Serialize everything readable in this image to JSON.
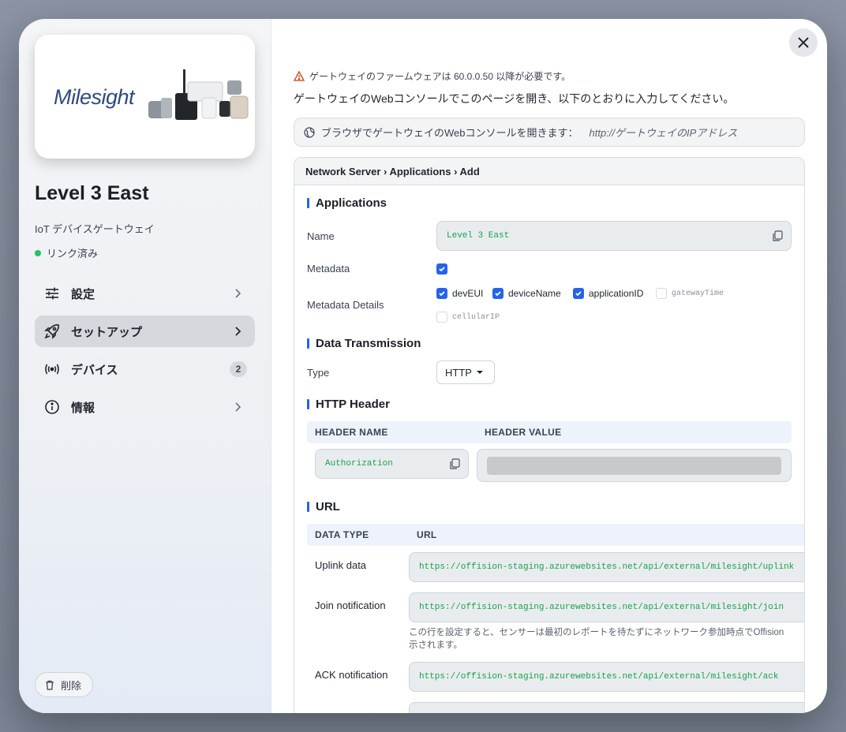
{
  "sidebar": {
    "logo_text": "Milesight",
    "title": "Level 3 East",
    "subtitle": "IoT デバイスゲートウェイ",
    "status": "リンク済み",
    "nav": [
      {
        "label": "設定",
        "icon": "sliders-icon"
      },
      {
        "label": "セットアップ",
        "icon": "rocket-icon"
      },
      {
        "label": "デバイス",
        "icon": "broadcast-icon",
        "badge": "2"
      },
      {
        "label": "情報",
        "icon": "info-icon"
      }
    ],
    "delete_label": "削除"
  },
  "main": {
    "warning": "ゲートウェイのファームウェアは 60.0.0.50 以降が必要です。",
    "intro": "ゲートウェイのWebコンソールでこのページを開き、以下のとおりに入力してください。",
    "browser_hint": "ブラウザでゲートウェイのWebコンソールを開きます：",
    "browser_url": "http://ゲートウェイのIPアドレス",
    "breadcrumb": "Network Server › Applications › Add",
    "applications": {
      "title": "Applications",
      "name_label": "Name",
      "name_value": "Level 3 East",
      "metadata_label": "Metadata",
      "metadata_checked": true,
      "metadata_details_label": "Metadata Details",
      "details": [
        {
          "label": "devEUI",
          "checked": true
        },
        {
          "label": "deviceName",
          "checked": true
        },
        {
          "label": "applicationID",
          "checked": true
        },
        {
          "label": "gatewayTime",
          "checked": false
        },
        {
          "label": "cellularIP",
          "checked": false
        }
      ]
    },
    "transmission": {
      "title": "Data Transmission",
      "type_label": "Type",
      "type_value": "HTTP"
    },
    "http_header": {
      "title": "HTTP Header",
      "col_name": "HEADER NAME",
      "col_value": "HEADER VALUE",
      "name_value": "Authorization"
    },
    "url": {
      "title": "URL",
      "col_type": "DATA TYPE",
      "col_url": "URL",
      "rows": [
        {
          "type": "Uplink data",
          "url": "https://offision-staging.azurewebsites.net/api/external/milesight/uplink"
        },
        {
          "type": "Join notification",
          "url": "https://offision-staging.azurewebsites.net/api/external/milesight/join"
        },
        {
          "type": "ACK notification",
          "url": "https://offision-staging.azurewebsites.net/api/external/milesight/ack"
        }
      ],
      "join_note": "この行を設定すると、センサーは最初のレポートを待たずにネットワーク参加時点でOffision",
      "join_note_2": "示されます。"
    }
  },
  "colors": {
    "accent": "#2563eb",
    "status_green": "#22c55e",
    "mono_green": "#16a34a"
  }
}
